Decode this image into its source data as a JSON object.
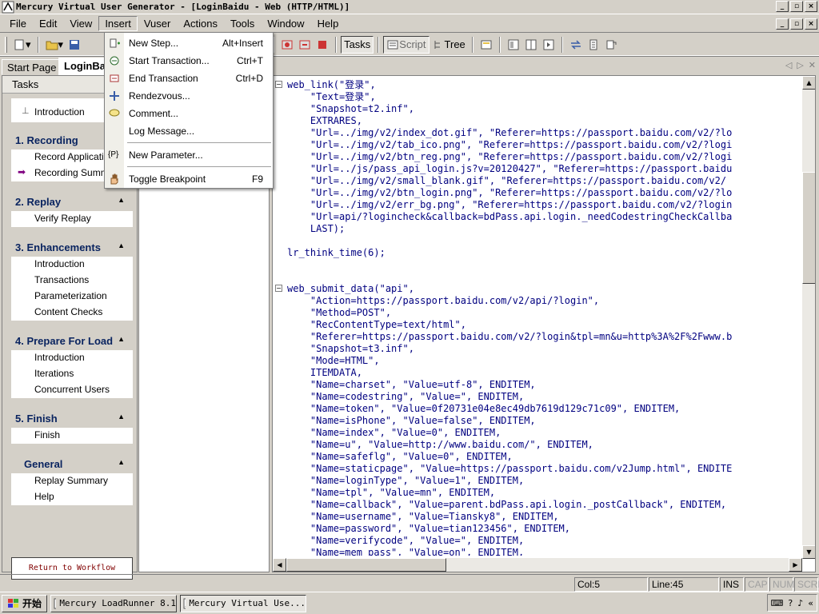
{
  "window": {
    "title": "Mercury Virtual User Generator - [LoginBaidu - Web (HTTP/HTML)]"
  },
  "menubar": [
    "File",
    "Edit",
    "View",
    "Insert",
    "Vuser",
    "Actions",
    "Tools",
    "Window",
    "Help"
  ],
  "toolbar": {
    "tasks_label": "Tasks",
    "script_label": "Script",
    "tree_label": "Tree"
  },
  "doc_tabs": [
    "Start Page",
    "LoginBaidu"
  ],
  "tasks_pane": {
    "header": "Tasks",
    "groups": [
      {
        "title": "",
        "items": [
          "Introduction"
        ]
      },
      {
        "title": "1. Recording",
        "items": [
          "Record Application",
          "Recording Summary"
        ]
      },
      {
        "title": "2. Replay",
        "items": [
          "Verify Replay"
        ]
      },
      {
        "title": "3. Enhancements",
        "items": [
          "Introduction",
          "Transactions",
          "Parameterization",
          "Content Checks"
        ]
      },
      {
        "title": "4. Prepare For Load",
        "items": [
          "Introduction",
          "Iterations",
          "Concurrent Users"
        ]
      },
      {
        "title": "5. Finish",
        "items": [
          "Finish"
        ]
      },
      {
        "title": "General",
        "items": [
          "Replay Summary",
          "Help"
        ]
      }
    ],
    "return_button": "Return to Workflow"
  },
  "insert_menu": {
    "items": [
      {
        "label": "New Step...",
        "shortcut": "Alt+Insert"
      },
      {
        "label": "Start Transaction...",
        "shortcut": "Ctrl+T"
      },
      {
        "label": "End Transaction",
        "shortcut": "Ctrl+D"
      },
      {
        "label": "Rendezvous...",
        "shortcut": ""
      },
      {
        "label": "Comment...",
        "shortcut": ""
      },
      {
        "label": "Log Message...",
        "shortcut": ""
      },
      {
        "label": "New Parameter...",
        "shortcut": ""
      },
      {
        "label": "Toggle Breakpoint",
        "shortcut": "F9"
      }
    ]
  },
  "code_lines": [
    "web_link(\"登录\",",
    "    \"Text=登录\",",
    "    \"Snapshot=t2.inf\",",
    "    EXTRARES,",
    "    \"Url=../img/v2/index_dot.gif\", \"Referer=https://passport.baidu.com/v2/?lo",
    "    \"Url=../img/v2/tab_ico.png\", \"Referer=https://passport.baidu.com/v2/?logi",
    "    \"Url=../img/v2/btn_reg.png\", \"Referer=https://passport.baidu.com/v2/?logi",
    "    \"Url=../js/pass_api_login.js?v=20120427\", \"Referer=https://passport.baidu",
    "    \"Url=../img/v2/small_blank.gif\", \"Referer=https://passport.baidu.com/v2/",
    "    \"Url=../img/v2/btn_login.png\", \"Referer=https://passport.baidu.com/v2/?lo",
    "    \"Url=../img/v2/err_bg.png\", \"Referer=https://passport.baidu.com/v2/?login",
    "    \"Url=api/?logincheck&callback=bdPass.api.login._needCodestringCheckCallba",
    "    LAST);",
    "",
    "lr_think_time(6);",
    "",
    "",
    "web_submit_data(\"api\",",
    "    \"Action=https://passport.baidu.com/v2/api/?login\",",
    "    \"Method=POST\",",
    "    \"RecContentType=text/html\",",
    "    \"Referer=https://passport.baidu.com/v2/?login&tpl=mn&u=http%3A%2F%2Fwww.b",
    "    \"Snapshot=t3.inf\",",
    "    \"Mode=HTML\",",
    "    ITEMDATA,",
    "    \"Name=charset\", \"Value=utf-8\", ENDITEM,",
    "    \"Name=codestring\", \"Value=\", ENDITEM,",
    "    \"Name=token\", \"Value=0f20731e04e8ec49db7619d129c71c09\", ENDITEM,",
    "    \"Name=isPhone\", \"Value=false\", ENDITEM,",
    "    \"Name=index\", \"Value=0\", ENDITEM,",
    "    \"Name=u\", \"Value=http://www.baidu.com/\", ENDITEM,",
    "    \"Name=safeflg\", \"Value=0\", ENDITEM,",
    "    \"Name=staticpage\", \"Value=https://passport.baidu.com/v2Jump.html\", ENDITE",
    "    \"Name=loginType\", \"Value=1\", ENDITEM,",
    "    \"Name=tpl\", \"Value=mn\", ENDITEM,",
    "    \"Name=callback\", \"Value=parent.bdPass.api.login._postCallback\", ENDITEM,",
    "    \"Name=username\", \"Value=Tiansky8\", ENDITEM,",
    "    \"Name=password\", \"Value=tian123456\", ENDITEM,",
    "    \"Name=verifycode\", \"Value=\", ENDITEM,",
    "    \"Name=mem_pass\", \"Value=on\", ENDITEM,"
  ],
  "statusbar": {
    "col": "Col:5",
    "line": "Line:45",
    "ins": "INS",
    "cap": "CAP",
    "num": "NUM",
    "scrl": "SCRL"
  },
  "taskbar": {
    "start": "开始",
    "tasks": [
      "Mercury LoadRunner 8.1",
      "Mercury Virtual Use..."
    ]
  }
}
